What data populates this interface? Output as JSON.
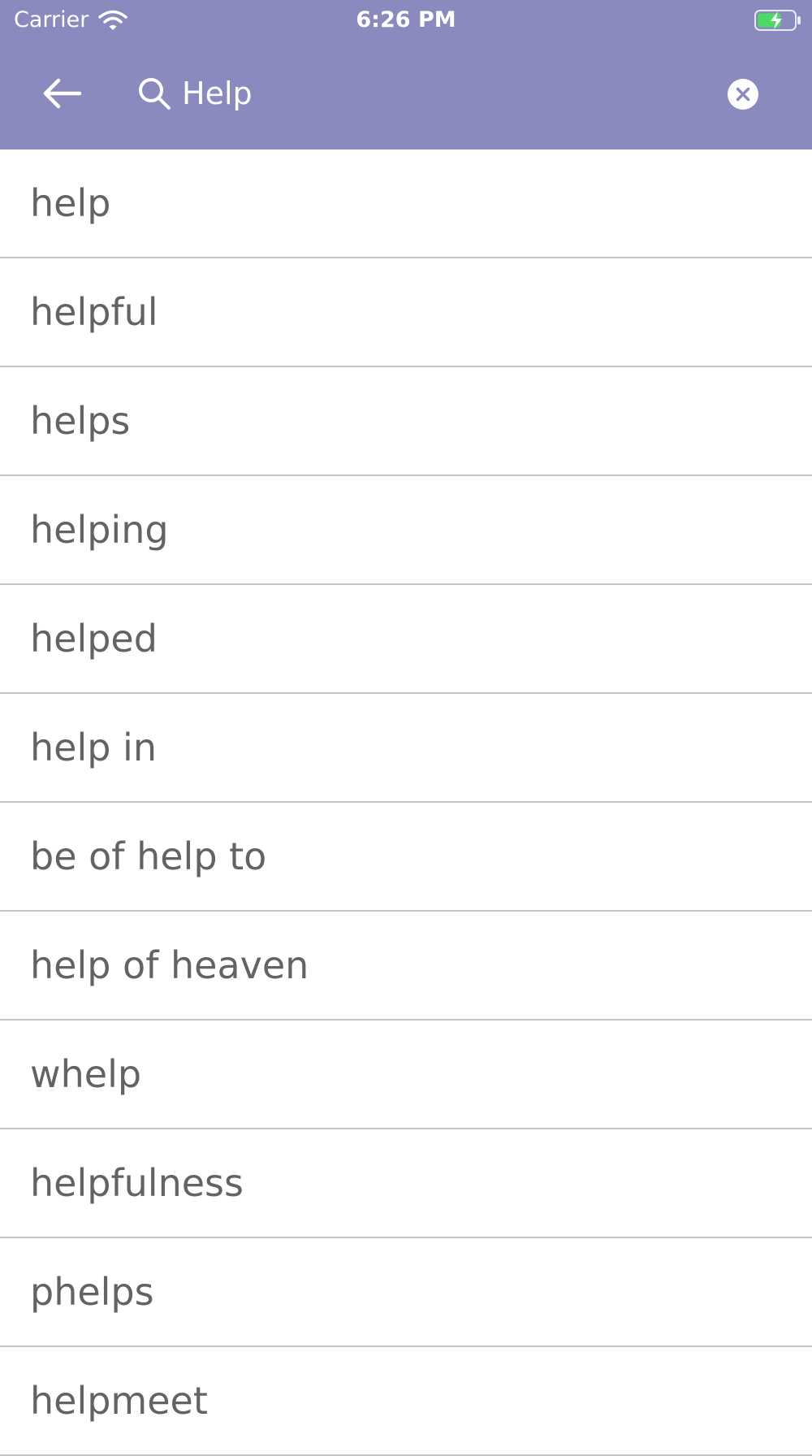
{
  "status_bar": {
    "carrier": "Carrier",
    "time": "6:26 PM",
    "icons": [
      "wifi-icon",
      "battery-charging-icon"
    ]
  },
  "search": {
    "query": "Help",
    "icons": [
      "back-arrow-icon",
      "search-icon",
      "clear-icon"
    ]
  },
  "colors": {
    "header_bg": "#8a8abe",
    "text": "#636363",
    "divider": "#c6c6c6",
    "battery_green": "#4cd964"
  },
  "results": [
    "help",
    "helpful",
    "helps",
    "helping",
    "helped",
    "help in",
    "be of help to",
    "help of heaven",
    "whelp",
    "helpfulness",
    "phelps",
    "helpmeet"
  ]
}
